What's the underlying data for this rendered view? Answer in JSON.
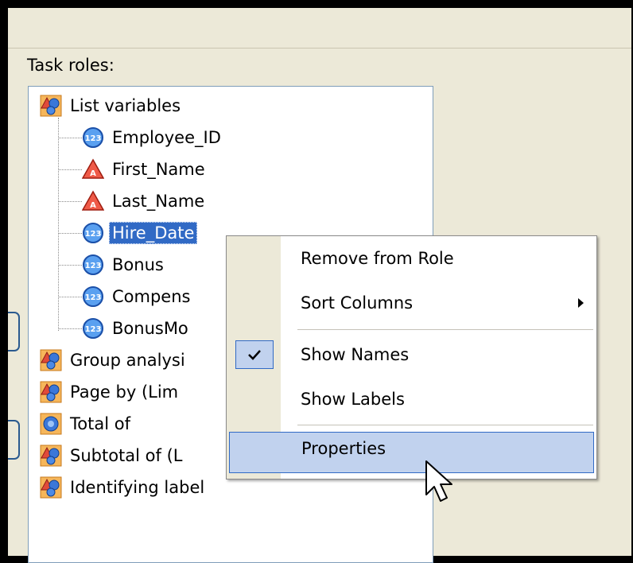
{
  "task_roles_label": "Task roles:",
  "tree": [
    {
      "label": "List variables",
      "icon": "role-group-icon"
    },
    {
      "label": "Employee_ID",
      "icon": "numeric-variable-icon"
    },
    {
      "label": "First_Name",
      "icon": "character-variable-icon"
    },
    {
      "label": "Last_Name",
      "icon": "character-variable-icon"
    },
    {
      "label": "Hire_Date",
      "icon": "numeric-variable-icon"
    },
    {
      "label": "Bonus",
      "icon": "numeric-variable-icon"
    },
    {
      "label": "Compens",
      "icon": "numeric-variable-icon"
    },
    {
      "label": "BonusMo",
      "icon": "numeric-variable-icon"
    },
    {
      "label": "Group analysi",
      "icon": "role-group-icon"
    },
    {
      "label": "Page by  (Lim",
      "icon": "role-group-icon"
    },
    {
      "label": "Total of",
      "icon": "numeric-role-icon"
    },
    {
      "label": "Subtotal of  (L",
      "icon": "role-group-icon"
    },
    {
      "label": "Identifying label",
      "icon": "role-group-icon"
    }
  ],
  "context_menu": {
    "items": [
      {
        "label": "Remove from Role"
      },
      {
        "label": "Sort Columns",
        "submenu_icon": "chevron-right-icon"
      },
      {
        "label": "Show Names",
        "checked": true
      },
      {
        "label": "Show Labels"
      },
      {
        "label": "Properties",
        "highlighted": true
      }
    ]
  },
  "colors": {
    "selection": "#316ac5",
    "menu_highlight": "#c1d2ee",
    "dialog_bg": "#ece9d8"
  }
}
